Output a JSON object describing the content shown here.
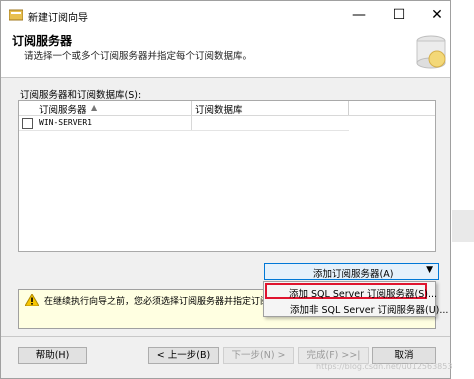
{
  "window": {
    "title": "新建订阅向导",
    "minimize_glyph": "—",
    "maximize_glyph": "☐",
    "close_glyph": "✕"
  },
  "header": {
    "title": "订阅服务器",
    "description": "请选择一个或多个订阅服务器并指定每个订阅数据库。"
  },
  "grid": {
    "label": "订阅服务器和订阅数据库(S):",
    "columns": [
      "订阅服务器",
      "订阅数据库"
    ],
    "sort_indicator": "▲",
    "rows": [
      {
        "checked": false,
        "subscriber": "WIN-SERVER1",
        "database": ""
      }
    ]
  },
  "add_button": {
    "label": "添加订阅服务器(A)",
    "arrow": "▼"
  },
  "menu": {
    "items": [
      {
        "label": "添加 SQL Server 订阅服务器(S)...",
        "highlighted": true
      },
      {
        "label": "添加非 SQL Server 订阅服务器(U)...",
        "highlighted": false
      }
    ]
  },
  "warning": {
    "text": "在继续执行向导之前，您必须选择订阅服务器并指定订阅"
  },
  "footer": {
    "help": "帮助(H)",
    "back": "< 上一步(B)",
    "next": "下一步(N) >",
    "finish": "完成(F) >>|",
    "cancel": "取消"
  },
  "watermark": "https://blog.csdn.net/u012563853",
  "colors": {
    "menu_highlight_border": "#e0142e",
    "dropdown_border": "#0078d7",
    "warning_bg": "#ffffe1"
  }
}
